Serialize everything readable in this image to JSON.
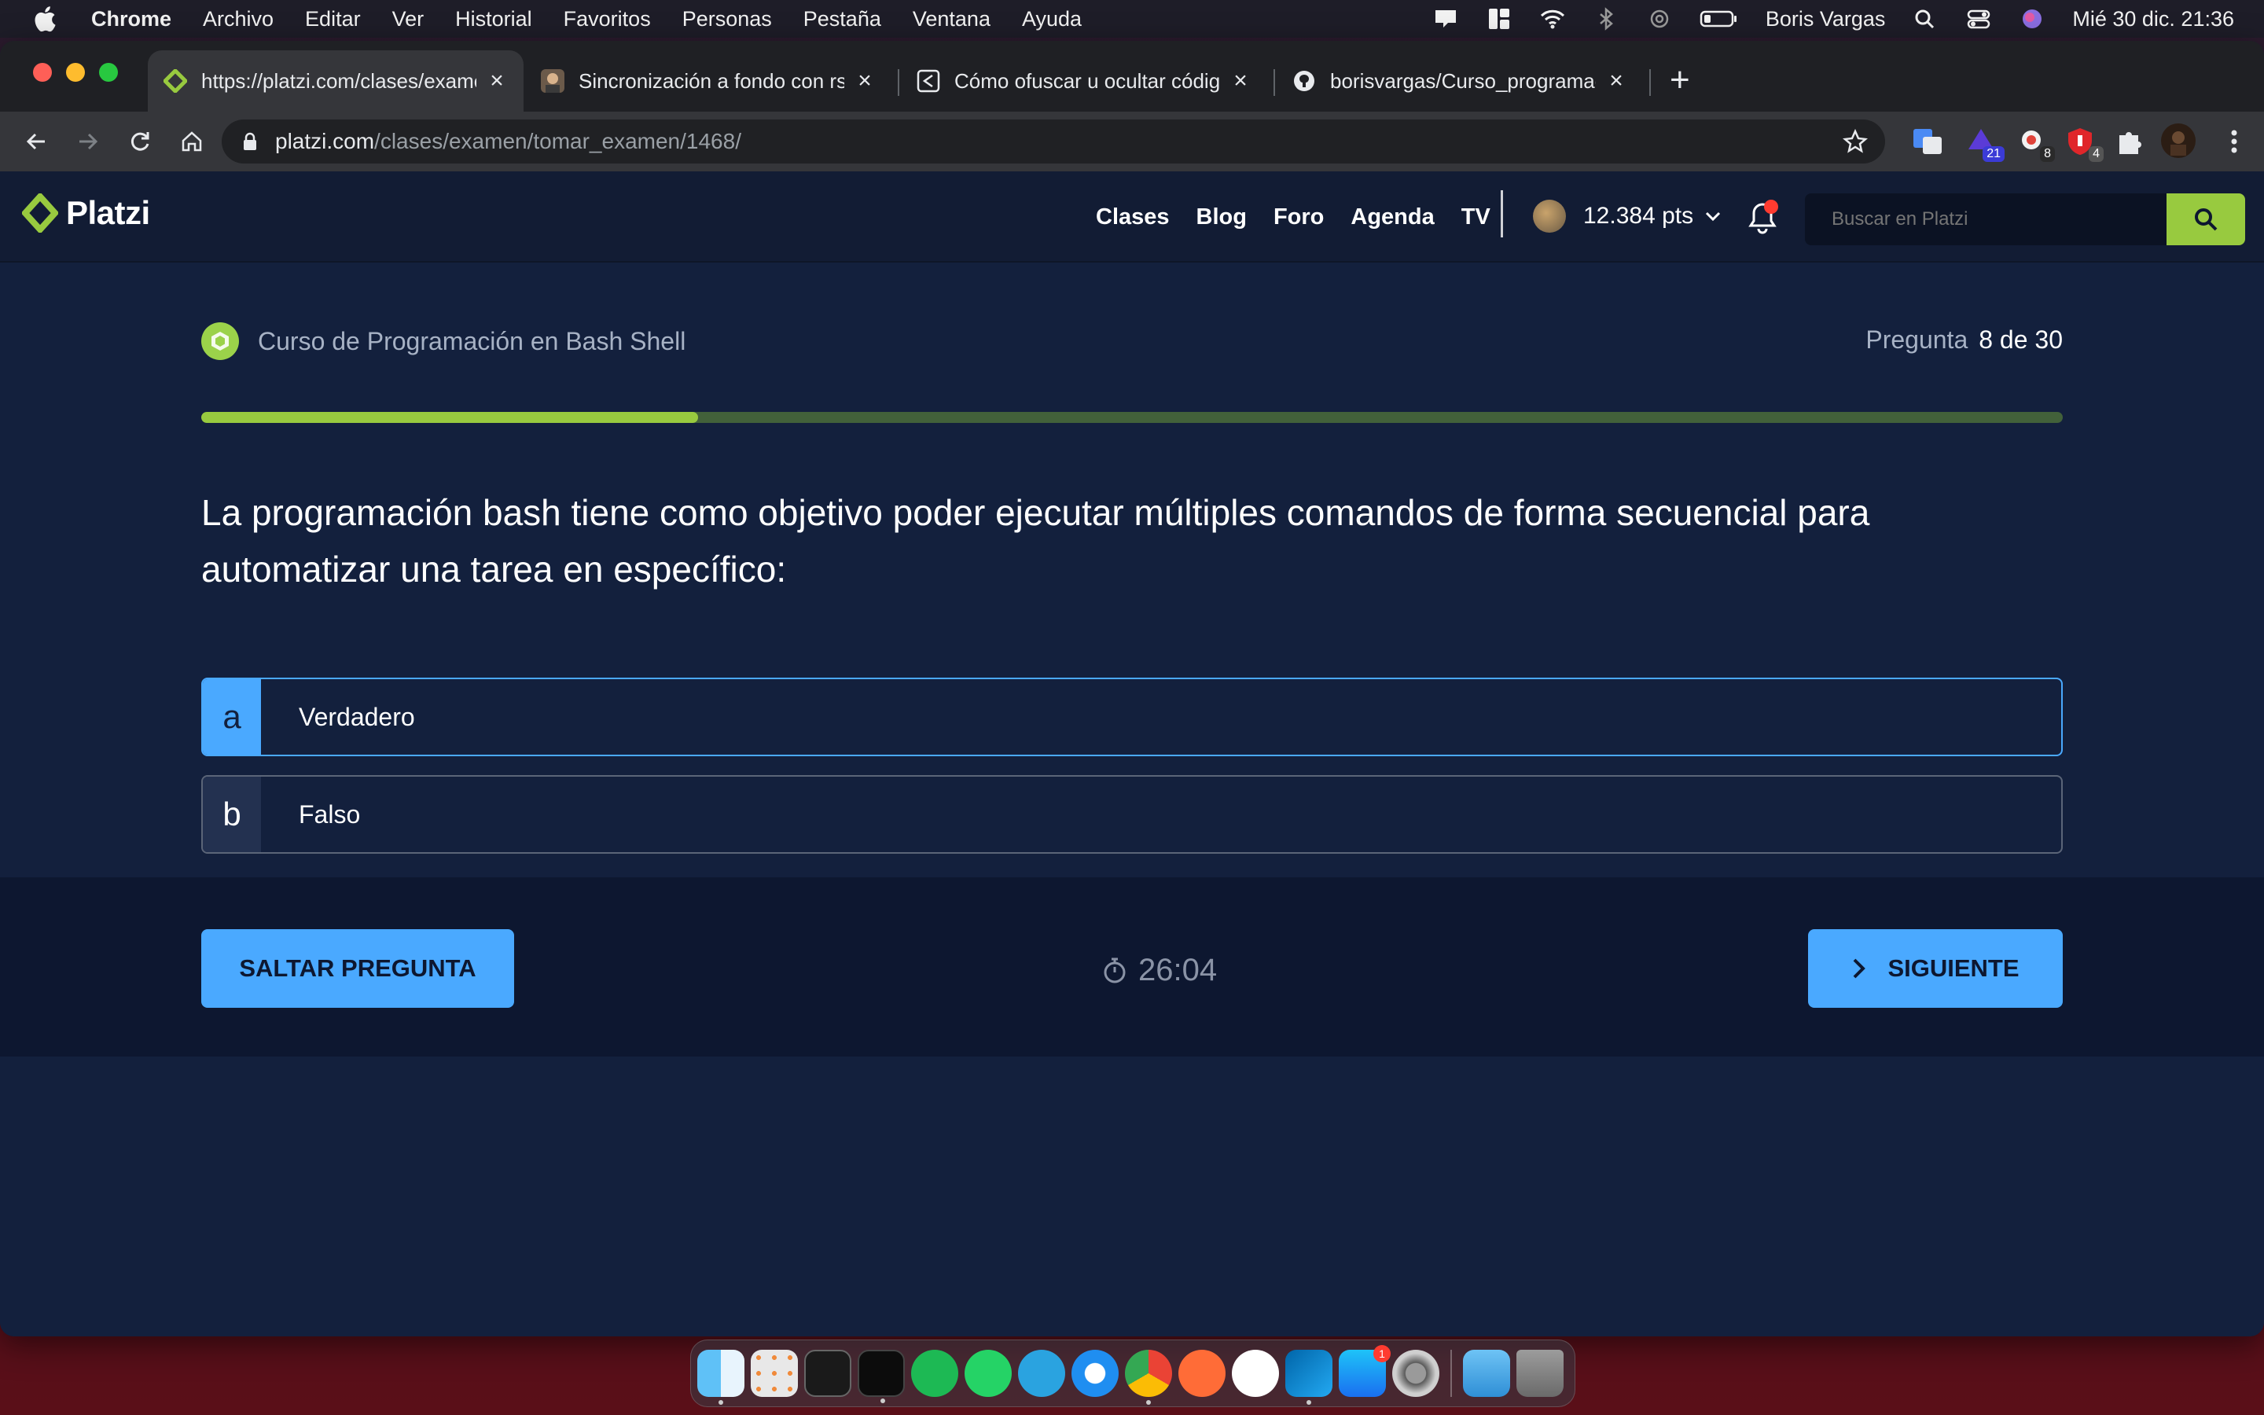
{
  "menubar": {
    "app_name": "Chrome",
    "items": [
      "Archivo",
      "Editar",
      "Ver",
      "Historial",
      "Favoritos",
      "Personas",
      "Pestaña",
      "Ventana",
      "Ayuda"
    ],
    "user": "Boris Vargas",
    "datetime": "Mié 30 dic.  21:36"
  },
  "browser": {
    "tabs": [
      {
        "title": "https://platzi.com/clases/exame",
        "favicon": "platzi-icon"
      },
      {
        "title": "Sincronización a fondo con rsyn",
        "favicon": "avatar-icon"
      },
      {
        "title": "Cómo ofuscar u ocultar código",
        "favicon": "share-icon"
      },
      {
        "title": "borisvargas/Curso_programaci",
        "favicon": "github-icon"
      }
    ],
    "url_host": "platzi.com",
    "url_path": "/clases/examen/tomar_examen/1468/",
    "extension_badges": {
      "ext2": "21",
      "ext3": "8",
      "ext4": "4"
    }
  },
  "site": {
    "logo_text": "Platzi",
    "nav": [
      "Clases",
      "Blog",
      "Foro",
      "Agenda",
      "TV"
    ],
    "points": "12.384 pts",
    "search_placeholder": "Buscar en Platzi"
  },
  "exam": {
    "course_name": "Curso de Programación en Bash Shell",
    "question_label": "Pregunta",
    "question_number": "8 de 30",
    "progress_fraction": 0.267,
    "question_text": "La programación bash tiene como objetivo poder ejecutar múltiples comandos de forma secuencial para automatizar una tarea en específico:",
    "options": [
      {
        "letter": "a",
        "text": "Verdadero",
        "selected": true
      },
      {
        "letter": "b",
        "text": "Falso",
        "selected": false
      }
    ],
    "skip_label": "SALTAR PREGUNTA",
    "timer": "26:04",
    "next_label": "SIGUIENTE"
  },
  "colors": {
    "accent_blue": "#4aa9ff",
    "platzi_green": "#98ca3f",
    "page_bg": "#13203d"
  },
  "dock": {
    "apps": [
      "finder-icon",
      "launchpad-icon",
      "terminal-icon",
      "iterm-icon",
      "spotify-icon",
      "whatsapp-icon",
      "telegram-icon",
      "safari-icon",
      "chrome-icon",
      "postman-icon",
      "sublime-icon",
      "vscode-icon",
      "appstore-icon",
      "settings-icon",
      "downloads-icon",
      "trash-icon"
    ],
    "appstore_badge": "1"
  }
}
